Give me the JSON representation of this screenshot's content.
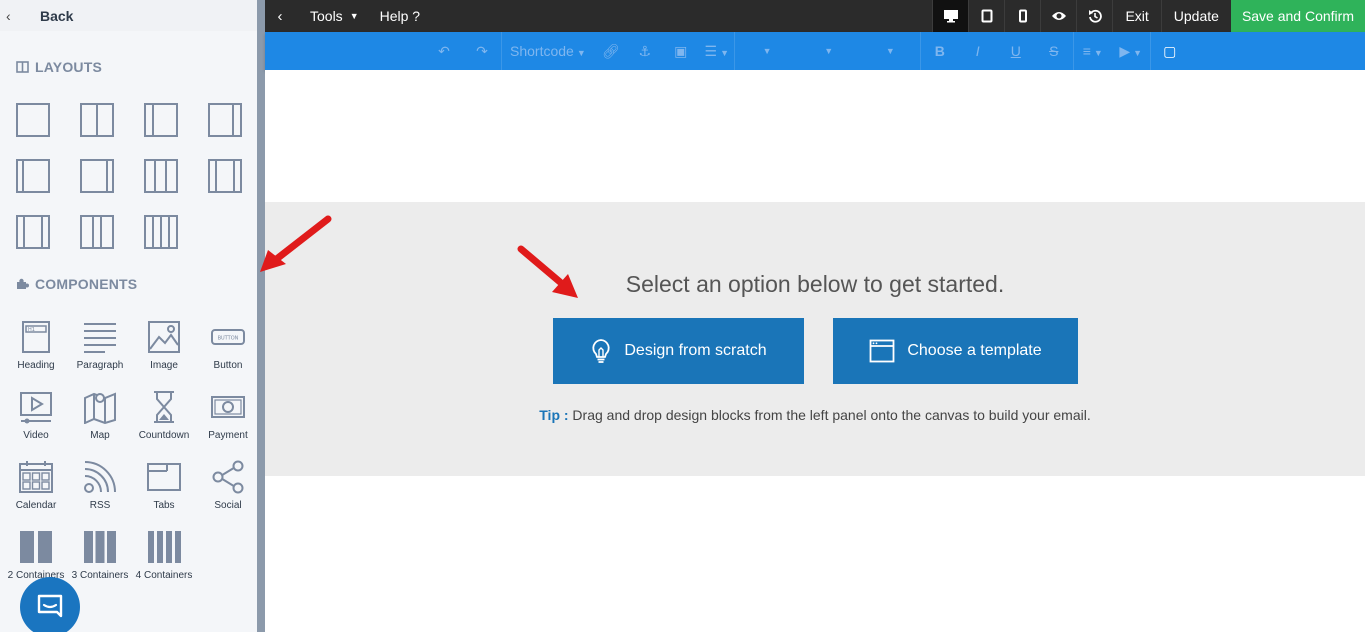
{
  "sidebar": {
    "back_label": "Back",
    "layouts_title": "LAYOUTS",
    "components_title": "COMPONENTS",
    "components": [
      {
        "label": "Heading",
        "icon": "heading-icon"
      },
      {
        "label": "Paragraph",
        "icon": "paragraph-icon"
      },
      {
        "label": "Image",
        "icon": "image-icon"
      },
      {
        "label": "Button",
        "icon": "button-icon",
        "icon_text": "BUTTON"
      },
      {
        "label": "Video",
        "icon": "video-icon"
      },
      {
        "label": "Map",
        "icon": "map-icon"
      },
      {
        "label": "Countdown",
        "icon": "hourglass-icon"
      },
      {
        "label": "Payment",
        "icon": "payment-icon"
      },
      {
        "label": "Calendar",
        "icon": "calendar-icon"
      },
      {
        "label": "RSS",
        "icon": "rss-icon"
      },
      {
        "label": "Tabs",
        "icon": "tabs-icon"
      },
      {
        "label": "Social",
        "icon": "share-icon"
      },
      {
        "label": "2 Containers",
        "icon": "two-containers-icon"
      },
      {
        "label": "3 Containers",
        "icon": "three-containers-icon"
      },
      {
        "label": "4 Containers",
        "icon": "four-containers-icon"
      }
    ]
  },
  "topbar": {
    "tools_label": "Tools",
    "help_label": "Help ?",
    "exit_label": "Exit",
    "update_label": "Update",
    "save_label": "Save and Confirm"
  },
  "editor_toolbar": {
    "shortcode_label": "Shortcode"
  },
  "canvas": {
    "prompt": "Select an option below to get started.",
    "design_button": "Design from scratch",
    "template_button": "Choose a template",
    "tip_label": "Tip :",
    "tip_text": " Drag and drop design blocks from the left panel onto the canvas to build your email."
  },
  "colors": {
    "topbar_bg": "#2b2b2b",
    "toolbar_bg": "#1e88e5",
    "save_bg": "#2fb35a",
    "primary_button": "#1a75b8",
    "sidebar_bg": "#f4f6f9",
    "arrow": "#e01b1b"
  }
}
